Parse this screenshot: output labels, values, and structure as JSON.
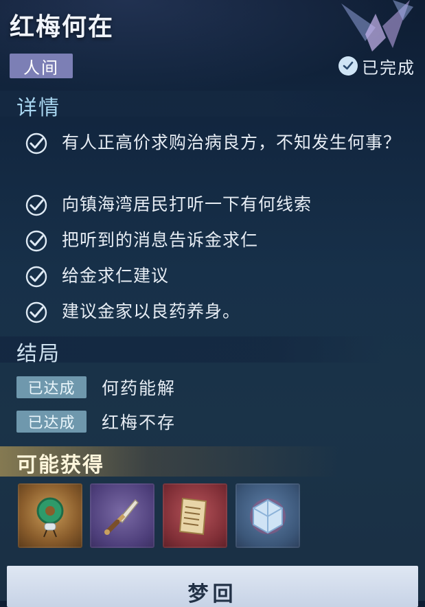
{
  "header": {
    "title": "红梅何在",
    "category": "人间",
    "status": "已完成"
  },
  "details": {
    "heading": "详情",
    "tasks": [
      "有人正高价求购治病良方，不知发生何事？",
      "向镇海湾居民打听一下有何线索",
      "把听到的消息告诉金求仁",
      "给金求仁建议",
      "建议金家以良药养身。"
    ]
  },
  "outcomes": {
    "heading": "结局",
    "items": [
      {
        "badge": "已达成",
        "text": "何药能解"
      },
      {
        "badge": "已达成",
        "text": "红梅不存"
      }
    ]
  },
  "rewards": {
    "heading": "可能获得",
    "items": [
      {
        "icon": "jade-pendant-icon"
      },
      {
        "icon": "dagger-icon"
      },
      {
        "icon": "scroll-icon"
      },
      {
        "icon": "crystal-cube-icon"
      }
    ]
  },
  "action": {
    "label": "梦回"
  },
  "colors": {
    "accent": "#a8d6f0",
    "badge_purple": "#7c7fb5",
    "badge_outcome": "#6f98ad",
    "button_bg": "#dfe7f3"
  }
}
